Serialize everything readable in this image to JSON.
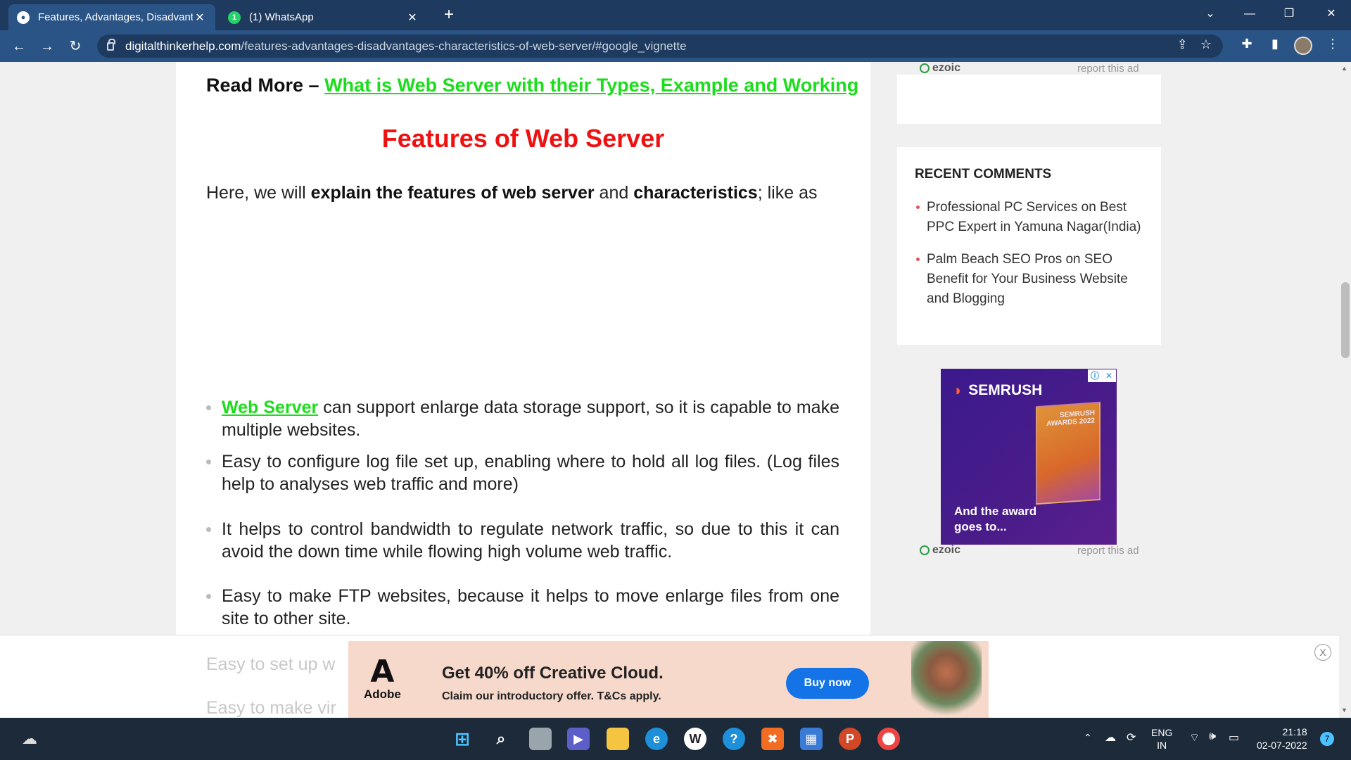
{
  "browser": {
    "tabs": [
      {
        "title": "Features, Advantages, Disadvanta",
        "active": true
      },
      {
        "title": "(1) WhatsApp",
        "active": false
      }
    ],
    "url_host": "digitalthinkerhelp.com",
    "url_path": "/features-advantages-disadvantages-characteristics-of-web-server/#google_vignette"
  },
  "article": {
    "readmore_label": "Read More –",
    "readmore_link": "What is Web Server with their Types, Example and Working",
    "heading": "Features of Web Server",
    "intro_pre": "Here, we will ",
    "intro_b1": "explain the features of web server",
    "intro_mid": " and ",
    "intro_b2": "characteristics",
    "intro_post": "; like as",
    "features": [
      {
        "link": "Web Server",
        "text": " can support enlarge data storage support, so it is capable to make multiple websites."
      },
      {
        "text": "Easy to configure log file set up, enabling where to hold all log files. (Log files help to analyses web traffic and more)"
      },
      {
        "text": "It helps to control bandwidth to regulate network traffic, so due to this it can avoid the down time while flowing high volume web traffic."
      },
      {
        "text": "Easy to make FTP websites, because it helps to move enlarge files from one site to other site."
      }
    ],
    "faded_1": "Easy to set up w",
    "faded_2": "Easy to make vir"
  },
  "sidebar": {
    "ezoic": "ezoic",
    "report": "report this ad",
    "recent_title": "RECENT COMMENTS",
    "comments": [
      "Professional PC Services on Best PPC Expert in Yamuna Nagar(India)",
      "Palm Beach SEO Pros on SEO Benefit for Your Business Website and Blogging"
    ],
    "semrush_brand": "SEMRUSH",
    "semrush_trophy": "SEMRUSH AWARDS 2022",
    "semrush_tag": "And the award goes to..."
  },
  "bottom_ad": {
    "brand": "Adobe",
    "headline": "Get 40% off Creative Cloud.",
    "sub": "Claim our introductory offer. T&Cs apply.",
    "cta": "Buy now",
    "close": "X"
  },
  "taskbar": {
    "lang1": "ENG",
    "lang2": "IN",
    "time": "21:18",
    "date": "02-07-2022",
    "notif": "7"
  }
}
